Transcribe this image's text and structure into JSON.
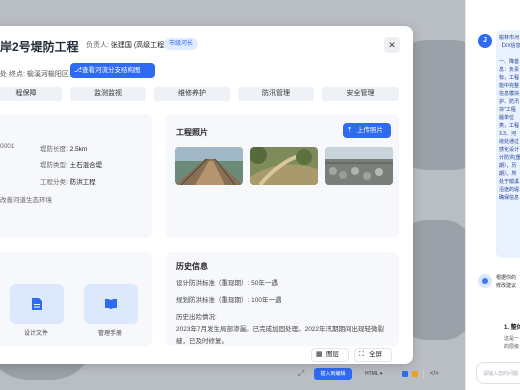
{
  "modal": {
    "title": "岸2号堤防工程",
    "owner_label": "负责人:",
    "owner_value": "张建国 (高级工程师)",
    "badge": "市级河长",
    "location": "处    终点: 榆溪河榆阳区界",
    "map_button": "查看河流分支结构图",
    "close": "✕"
  },
  "tabs": [
    "程保障",
    "监测监视",
    "维修养护",
    "防汛管理",
    "安全管理"
  ],
  "basic_info": {
    "code_partial": "0001",
    "length_label": "堤防长度:",
    "length_value": "2.5km",
    "type_label": "堤防类型:",
    "type_value": "土石混合堤",
    "category_label": "工程分类:",
    "category_value": "防洪工程",
    "goal_partial": "改善河道生态环境"
  },
  "photos": {
    "heading": "工程照片",
    "upload_button": "上传照片"
  },
  "history": {
    "heading": "历史信息",
    "design_flood": "设计防洪标准（重现期）: 50年一遇",
    "plan_flood": "规划防洪标准（重现期）: 100年一遇",
    "past_label": "历史出险情况:",
    "past_text_1": "2023年7月发生局部渗漏。已完成加固处理。2022年汛期期间出现轻微裂",
    "past_text_2": "缝，已及时修复。"
  },
  "documents": {
    "doc1": "设计文件",
    "doc2": "管理手册"
  },
  "footer": {
    "layer_button": "图层",
    "fullscreen_button": "全屏"
  },
  "toolbar": {
    "insert_button": "插入到编辑",
    "format": "HTML",
    "code_icon": "</>"
  },
  "chat": {
    "avatar": "J",
    "message_lines": [
      "榆林市河",
      "【XX信息",
      "",
      "一、降首",
      "息：负责",
      "标，工程",
      "能中完整",
      "信息模块",
      "护、防汛",
      "块\"工程",
      "履单位",
      "类，工程",
      "3.3、河",
      "绕处通过",
      "感化设计",
      "计防洪(重",
      "期），历",
      "期）。所",
      "处于榆溪",
      "沿途的堤",
      "确保信息"
    ],
    "reply_lines": [
      "根据你的",
      "修改建议"
    ],
    "section_title": "1. 整体",
    "section_lines": [
      "这是一",
      "的层级"
    ],
    "input_placeholder": "请输入您的问题"
  }
}
